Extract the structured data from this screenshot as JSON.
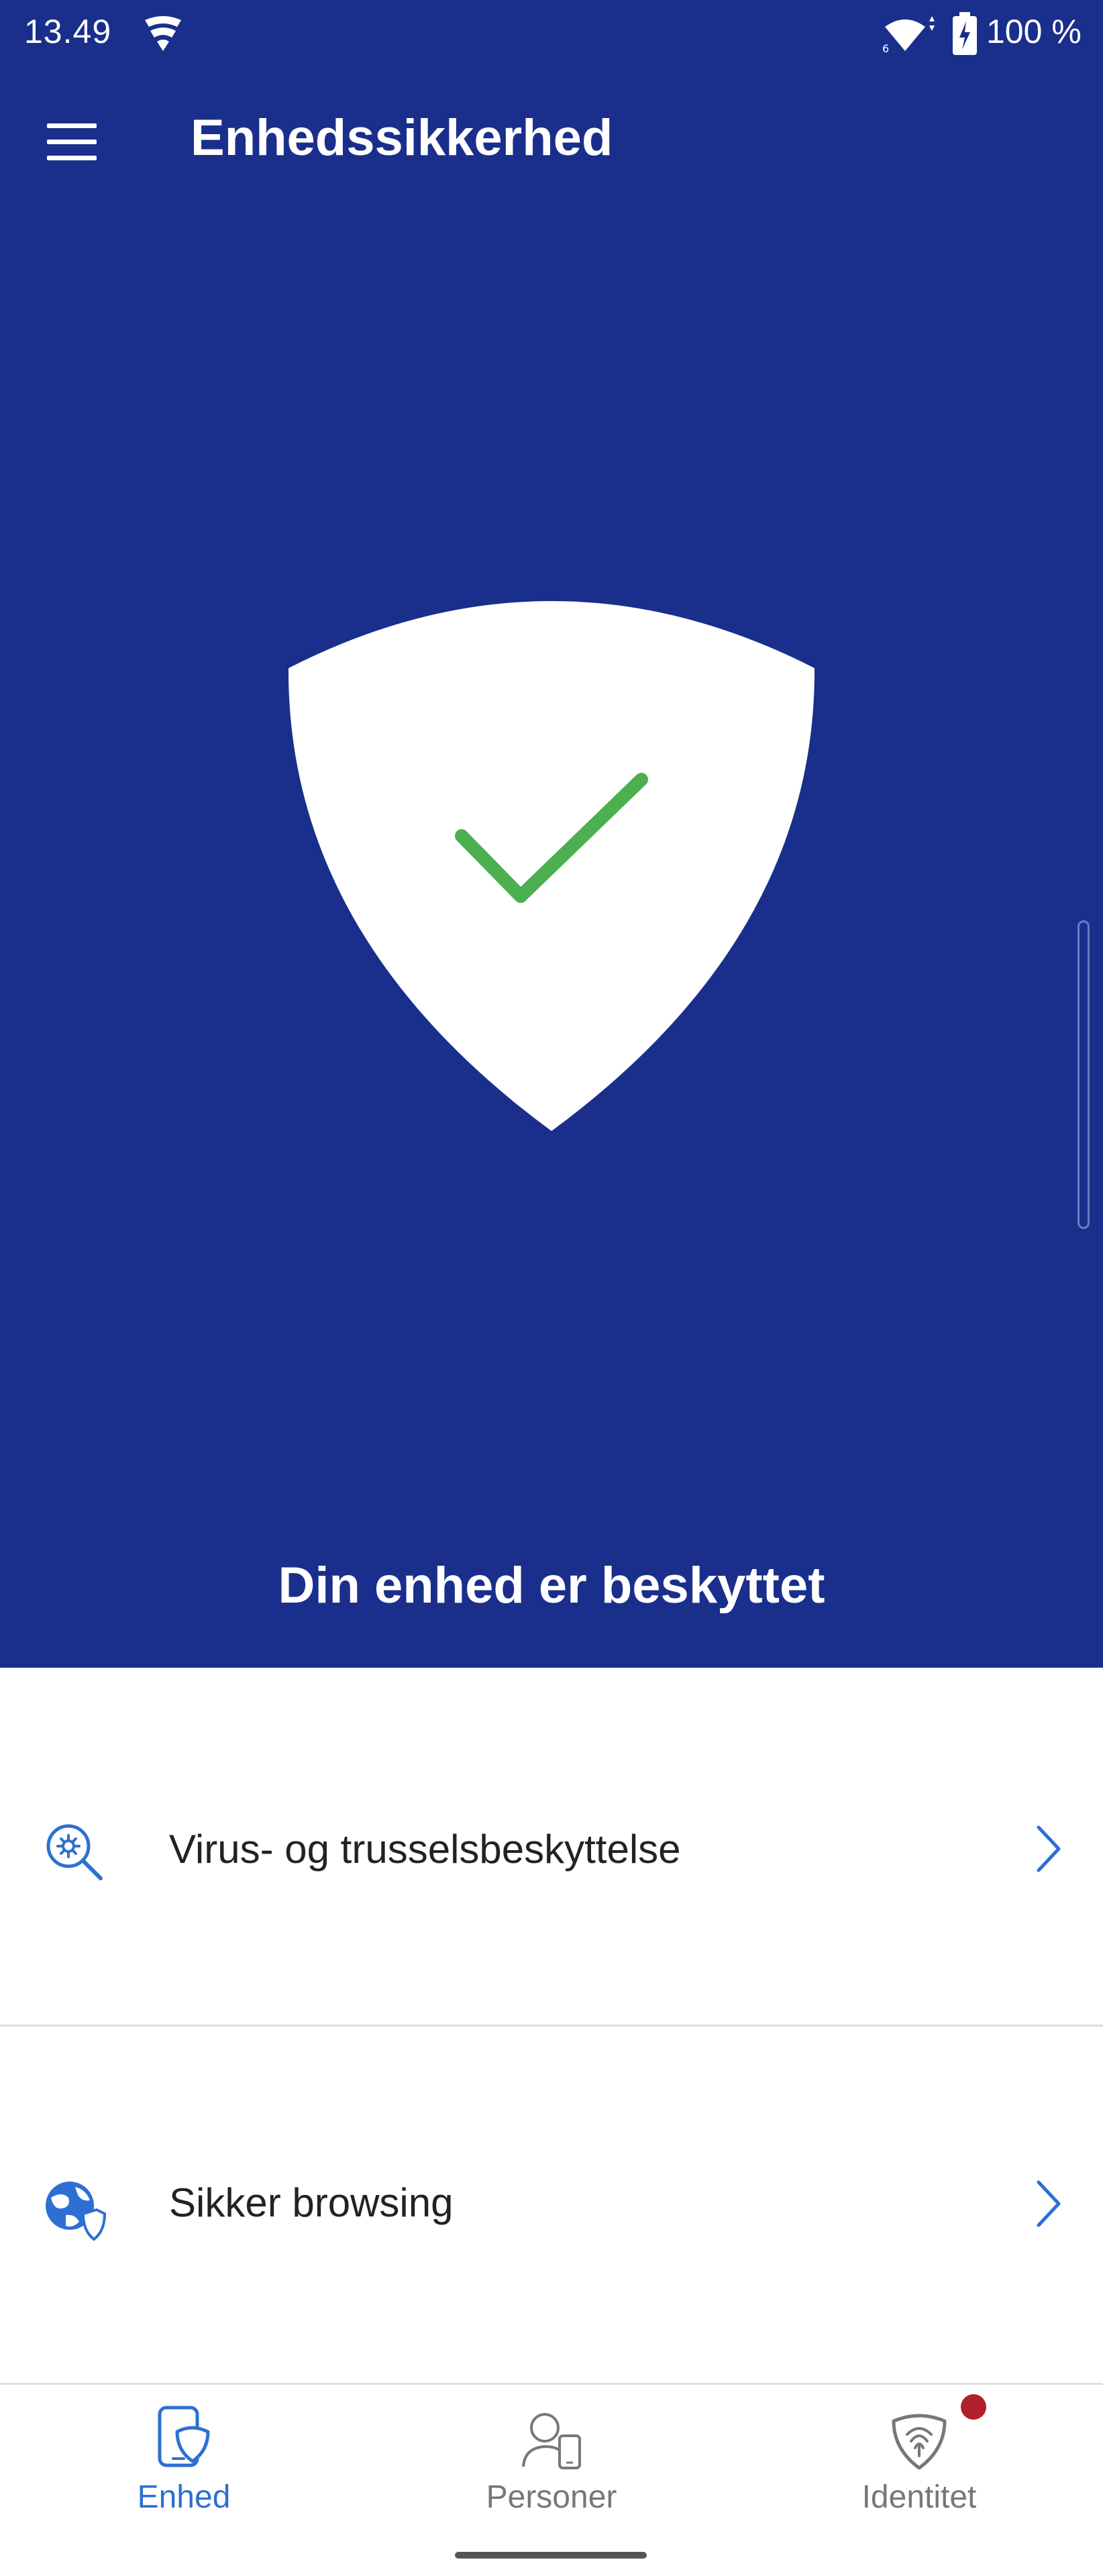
{
  "status_bar": {
    "time": "13.49",
    "battery": "100 %"
  },
  "app_bar": {
    "title": "Enhedssikkerhed",
    "menu_icon": "hamburger-menu-icon"
  },
  "hero": {
    "icon": "shield-check-icon",
    "status_text": "Din enhed er beskyttet"
  },
  "features": [
    {
      "label": "Virus- og trusselsbeskyttelse",
      "icon": "virus-search-icon"
    },
    {
      "label": "Sikker browsing",
      "icon": "globe-shield-icon"
    }
  ],
  "bottom_nav": {
    "tabs": [
      {
        "label": "Enhed",
        "icon": "phone-shield-icon",
        "active": true
      },
      {
        "label": "Personer",
        "icon": "person-device-icon",
        "active": false
      },
      {
        "label": "Identitet",
        "icon": "fingerprint-shield-icon",
        "active": false,
        "notification": true
      }
    ]
  },
  "colors": {
    "hero_background": "#1a2f8c",
    "accent": "#2d6fd3",
    "check": "#4caf50",
    "notification": "#b0202a"
  }
}
